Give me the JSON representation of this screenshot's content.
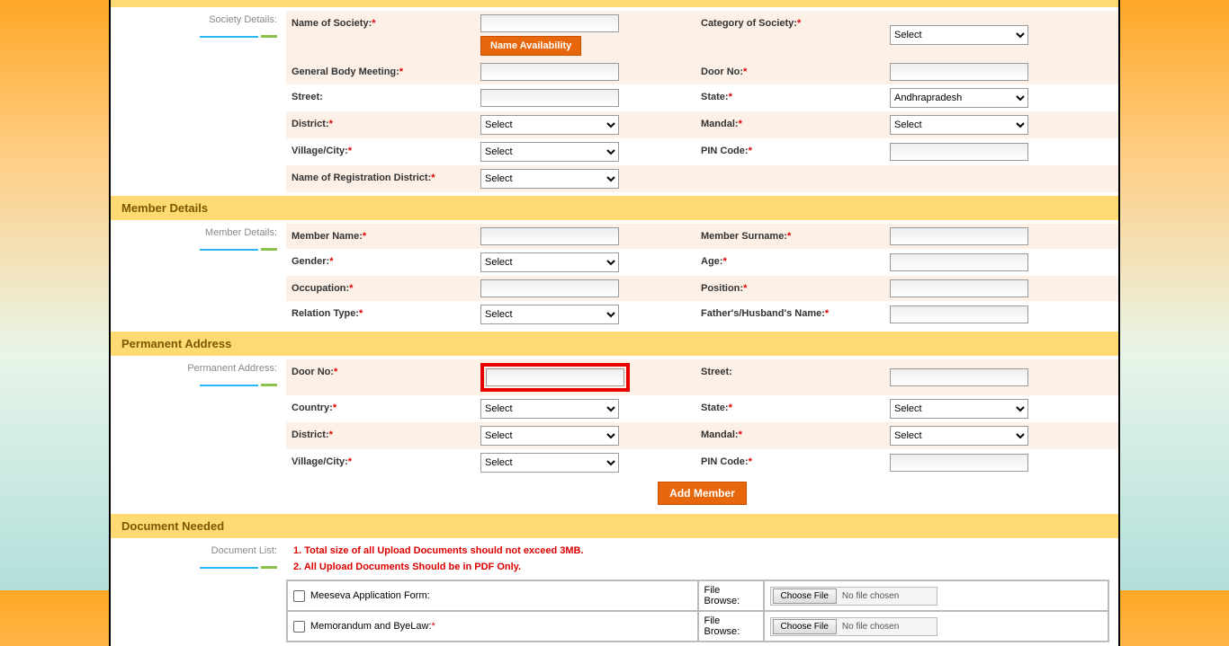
{
  "sections": {
    "society_details": "Society Details:",
    "member_details_header": "Member Details",
    "member_details_label": "Member Details:",
    "permanent_address_header": "Permanent Address",
    "permanent_address_label": "Permanent Address:",
    "document_needed_header": "Document Needed",
    "document_list_label": "Document List:"
  },
  "society": {
    "name_label": "Name of  Society:",
    "name_avail_btn": "Name Availability",
    "category_label": "Category of Society:",
    "category_value": "Select",
    "gbm_label": "General Body Meeting:",
    "door_label": "Door No:",
    "street_label": "Street:",
    "state_label": "State:",
    "state_value": "Andhrapradesh",
    "district_label": "District:",
    "district_value": "Select",
    "mandal_label": "Mandal:",
    "mandal_value": "Select",
    "village_label": "Village/City:",
    "village_value": "Select",
    "pin_label": "PIN Code:",
    "regdist_label": "Name of Registration District:",
    "regdist_value": "Select"
  },
  "member": {
    "name_label": "Member Name:",
    "surname_label": "Member Surname:",
    "gender_label": "Gender:",
    "gender_value": "Select",
    "age_label": "Age:",
    "occupation_label": "Occupation:",
    "position_label": "Position:",
    "relation_label": "Relation Type:",
    "relation_value": "Select",
    "fh_name_label": "Father's/Husband's Name:"
  },
  "perm": {
    "door_label": "Door No:",
    "street_label": "Street:",
    "country_label": "Country:",
    "country_value": "Select",
    "state_label": "State:",
    "state_value": "Select",
    "district_label": "District:",
    "district_value": "Select",
    "mandal_label": "Mandal:",
    "mandal_value": "Select",
    "village_label": "Village/City:",
    "village_value": "Select",
    "pin_label": "PIN Code:",
    "add_member_btn": "Add Member"
  },
  "docs": {
    "warn1": "1. Total size of all Upload Documents should not exceed 3MB.",
    "warn2": "2. All Upload Documents Should be in PDF Only.",
    "file_browse_label": "File Browse:",
    "choose_file_btn": "Choose File",
    "no_file": "No file chosen",
    "items": [
      {
        "label": "Meeseva Application Form:"
      },
      {
        "label": "Memorandum and ByeLaw:",
        "required": true
      }
    ]
  }
}
